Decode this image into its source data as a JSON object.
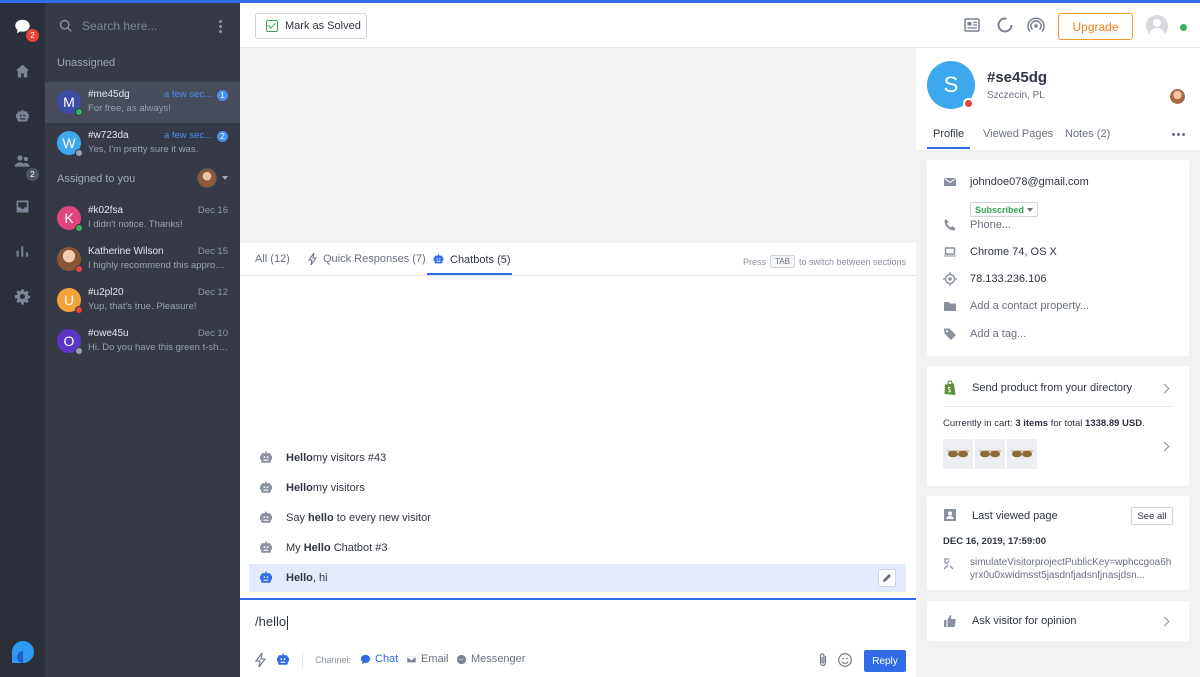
{
  "rail": {
    "chat_badge": "2",
    "contacts_badge": "2"
  },
  "conversations": {
    "search_placeholder": "Search here...",
    "unassigned_title": "Unassigned",
    "assigned_title": "Assigned to you",
    "items": [
      {
        "initial": "M",
        "name": "#me45dg",
        "time": "a few sec...",
        "count": "1",
        "message": "For free, as always!",
        "color": "#3b4ea3",
        "status": "#35b45b"
      },
      {
        "initial": "W",
        "name": "#w723da",
        "time": "a few sec...",
        "count": "2",
        "message": "Yes, I'm pretty sure it was.",
        "color": "#3ea8ee",
        "status": "#9aa1ae"
      },
      {
        "initial": "K",
        "name": "#k02fsa",
        "time": "Dec 16",
        "message": "I didn't notice. Thanks!",
        "color": "#e0457b",
        "status": "#35b45b"
      },
      {
        "initial": "",
        "name": "Katherine Wilson",
        "time": "Dec 15",
        "message": "I highly recommend this approach t...",
        "color": "#c89a78",
        "status": "#e5443a"
      },
      {
        "initial": "U",
        "name": "#u2pl20",
        "time": "Dec 12",
        "message": "Yup, that's true. Pleasure!",
        "color": "#f2a33a",
        "status": "#e5443a"
      },
      {
        "initial": "O",
        "name": "#owe45u",
        "time": "Dec 10",
        "message": "Hi. Do you have this green t-shirt?",
        "color": "#5b36c9",
        "status": "#9aa1ae"
      }
    ]
  },
  "topbar": {
    "solve_label": "Mark as Solved",
    "upgrade_label": "Upgrade"
  },
  "chat": {
    "tabs": [
      {
        "label": "All (12)"
      },
      {
        "label": "Quick Responses (7)"
      },
      {
        "label": "Chatbots (5)"
      }
    ],
    "hint_press": "Press",
    "hint_key": "TAB",
    "hint_rest": "to switch between sections",
    "responses": [
      {
        "bold": "Hello",
        "rest": " my visitors #43"
      },
      {
        "bold": "Hello",
        "rest": " my visitors"
      },
      {
        "pre": "Say ",
        "bold": "hello",
        "rest": " to every new visitor"
      },
      {
        "pre": "My ",
        "bold": "Hello",
        "rest": " Chatbot #3"
      },
      {
        "bold": "Hello",
        "rest": ", hi"
      }
    ],
    "composer_text": "/hello",
    "channel_label": "Channel:",
    "channels": [
      "Chat",
      "Email",
      "Messenger"
    ],
    "reply_label": "Reply"
  },
  "visitor": {
    "initial": "S",
    "name": "#se45dg",
    "location": "Szczecin, PL",
    "tabs": [
      "Profile",
      "Viewed Pages",
      "Notes (2)"
    ],
    "email": "johndoe078@gmail.com",
    "subscription": "Subscribed",
    "phone": "Phone...",
    "browser": "Chrome 74, OS X",
    "ip": "78.133.236.106",
    "add_property": "Add a contact property...",
    "add_tag": "Add a tag...",
    "product_title": "Send product from your directory",
    "cart_prefix": "Currently in cart: ",
    "cart_items": "3 items",
    "cart_mid": " for total ",
    "cart_total": "1338.89 USD",
    "cart_suffix": ".",
    "last_viewed_title": "Last viewed page",
    "see_all": "See all",
    "last_viewed_date": "DEC 16, 2019, 17:59:00",
    "last_viewed_url": "simulateVisitorprojectPublicKey=wphccgoa6hyrx0u0xwidmsst5jasdnfjadsnfjnasjdsn...",
    "opinion_title": "Ask visitor for opinion"
  }
}
